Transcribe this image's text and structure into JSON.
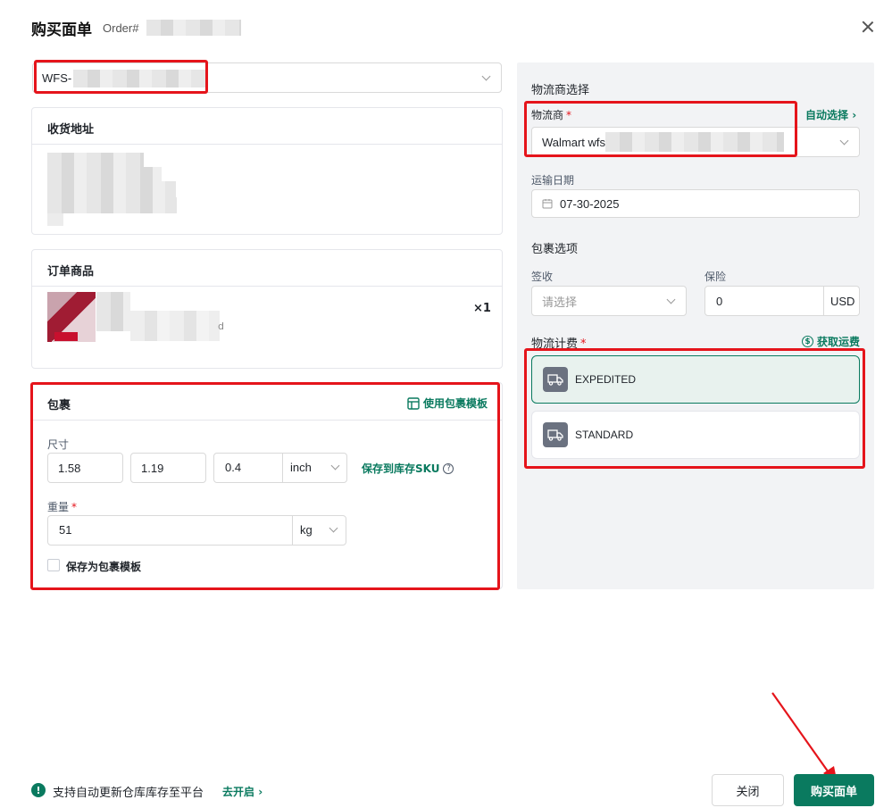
{
  "header": {
    "title": "购买面单",
    "order_prefix": "Order#"
  },
  "shipment_select": {
    "value": "WFS-"
  },
  "address_card": {
    "title": "收货地址"
  },
  "items_card": {
    "title": "订单商品",
    "quantity": "×1",
    "sku_tail": "d"
  },
  "package_card": {
    "title": "包裹",
    "use_template": "使用包裹模板",
    "size_label": "尺寸",
    "length": "1.58",
    "width": "1.19",
    "height": "0.4",
    "length_unit": "inch",
    "save_sku": "保存到库存SKU",
    "help_icon": "?",
    "weight_label": "重量",
    "required_mark": "*",
    "weight": "51",
    "weight_unit": "kg",
    "save_template": "保存为包裹模板"
  },
  "carrier_section": {
    "title": "物流商选择",
    "carrier_label": "物流商",
    "auto_select": "自动选择",
    "carrier_value": "Walmart wfs",
    "ship_date_label": "运输日期",
    "ship_date": "07-30-2025"
  },
  "package_options": {
    "title": "包裹选项",
    "signature_label": "签收",
    "signature_placeholder": "请选择",
    "insurance_label": "保险",
    "insurance_value": "0",
    "insurance_currency": "USD"
  },
  "rates": {
    "title": "物流计费",
    "get_rates": "获取运费",
    "options": [
      {
        "name": "EXPEDITED",
        "selected": true
      },
      {
        "name": "STANDARD",
        "selected": false
      }
    ]
  },
  "footer": {
    "info_icon": "!",
    "info_text": "支持自动更新仓库库存至平台",
    "enable_link": "去开启",
    "close_button": "关闭",
    "buy_button": "购买面单"
  },
  "colors": {
    "accent": "#0a7a5f",
    "highlight_red": "#e5141b",
    "panel_bg": "#f2f3f5"
  }
}
